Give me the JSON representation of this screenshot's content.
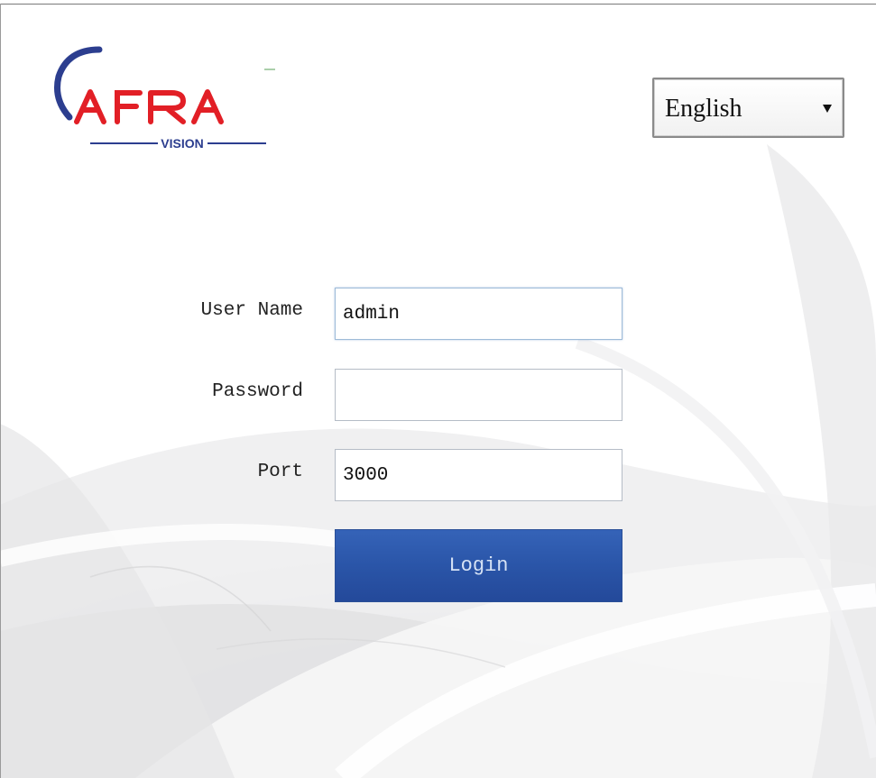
{
  "brand": {
    "logo_text": "AFRA",
    "logo_subtext": "VISION",
    "primary_color": "#e21f26",
    "secondary_color": "#2c3e8f"
  },
  "language_select": {
    "selected": "English",
    "arrow_icon": "dropdown-arrow-icon"
  },
  "form": {
    "username": {
      "label": "User Name",
      "value": "admin"
    },
    "password": {
      "label": "Password",
      "value": ""
    },
    "port": {
      "label": "Port",
      "value": "3000"
    },
    "login_label": "Login",
    "button_color": "#2a55a8"
  }
}
